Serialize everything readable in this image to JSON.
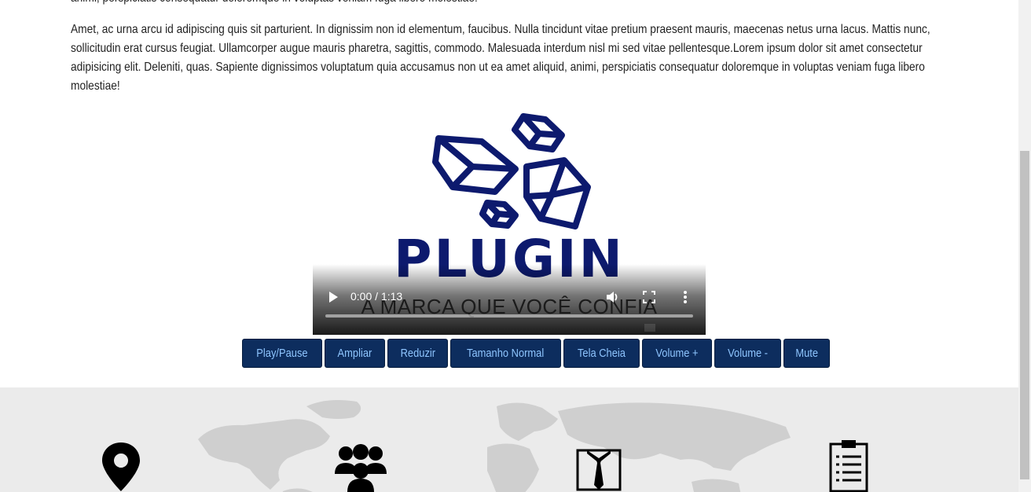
{
  "article": {
    "cut_line": "animi, perspiciatis consequatur doloremque in voluptas veniam fuga libero molestiae!",
    "paragraph": "Amet, ac urna arcu id adipiscing quis sit parturient. In dignissim non id elementum, faucibus. Nulla tincidunt vitae pretium praesent mauris, maecenas netus urna lacus. Mattis nunc, sollicitudin erat cursus feugiat. Ullamcorper augue mauris pharetra, sagittis, commodo. Malesuada interdum nisl mi sed vitae pellentesque.Lorem ipsum dolor sit amet consectetur adipisicing elit. Deleniti, quas. Sapiente dignissimos voluptatum quia accusamus non ut ea amet aliquid, animi, perspiciatis consequatur doloremque in voluptas veniam fuga libero molestiae!"
  },
  "video": {
    "logo_text": "PLUGIN",
    "tagline": "A MARCA QUE VOCÊ CONFIA",
    "time": "0:00 / 1:13",
    "progress": 0,
    "logo_color": "#0d1a6e"
  },
  "video_buttons": [
    {
      "label": "Play/Pause",
      "name": "play-pause-button"
    },
    {
      "label": "Ampliar",
      "name": "ampliar-button"
    },
    {
      "label": "Reduzir",
      "name": "reduzir-button"
    },
    {
      "label": "Tamanho Normal",
      "name": "tamanho-normal-button"
    },
    {
      "label": "Tela Cheia",
      "name": "tela-cheia-button"
    },
    {
      "label": "Volume +",
      "name": "volume-up-button"
    },
    {
      "label": "Volume -",
      "name": "volume-down-button"
    },
    {
      "label": "Mute",
      "name": "mute-button"
    }
  ],
  "features": {
    "icons": [
      "map-pin-icon",
      "users-group-icon",
      "suit-tie-icon",
      "clipboard-list-icon"
    ]
  }
}
